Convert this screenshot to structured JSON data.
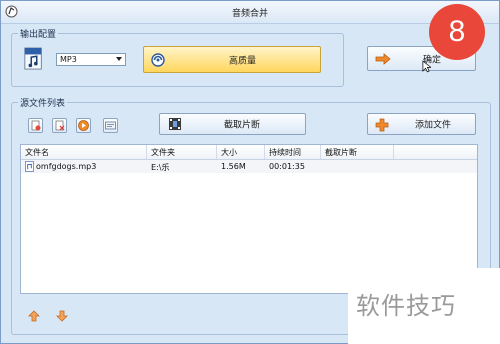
{
  "window": {
    "title": "音频合并"
  },
  "output_settings": {
    "label": "输出配置",
    "format_value": "MP3",
    "quality_label": "高质量",
    "ok_label": "确定"
  },
  "source_files": {
    "label": "源文件列表",
    "clip_label": "截取片断",
    "add_label": "添加文件",
    "columns": [
      "文件名",
      "文件夹",
      "大小",
      "持续时间",
      "截取片断"
    ],
    "rows": [
      {
        "name": "omfgdogs.mp3",
        "folder": "E:\\乐",
        "size": "1.56M",
        "duration": "00:01:35",
        "clip": ""
      }
    ]
  },
  "overlay": {
    "step_number": "8",
    "watermark": "软件技巧"
  },
  "colors": {
    "badge": "#e8473a",
    "window_bg": "#d8e7f6",
    "button_highlight": "#ffd65d"
  },
  "icons": [
    "app-icon",
    "music-file-icon",
    "format-icon",
    "arrow-right-icon",
    "clip-icon",
    "plus-icon",
    "delete-icon",
    "clear-icon",
    "play-icon",
    "info-icon",
    "mp3-file-icon",
    "move-up-icon",
    "move-down-icon"
  ]
}
